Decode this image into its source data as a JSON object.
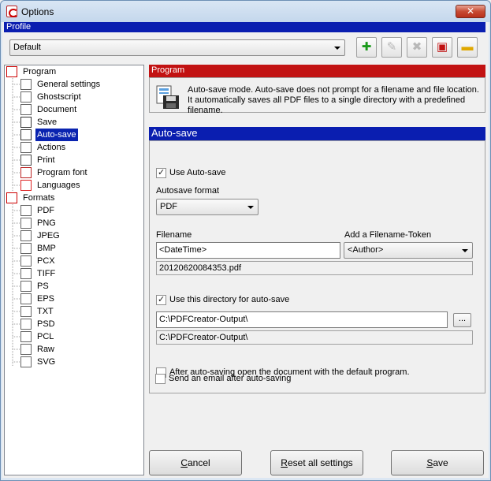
{
  "window": {
    "title": "Options",
    "close_glyph": "✕"
  },
  "profile": {
    "header": "Profile",
    "selected": "Default",
    "toolbar": [
      {
        "name": "add-profile-button",
        "icon": "plus-icon",
        "glyph": "✚",
        "color": "#1a9a1a",
        "disabled": false
      },
      {
        "name": "rename-profile-button",
        "icon": "rename-icon",
        "glyph": "✎",
        "color": "#b8b8b8",
        "disabled": true
      },
      {
        "name": "delete-profile-button",
        "icon": "delete-icon",
        "glyph": "✖",
        "color": "#b8b8b8",
        "disabled": true
      },
      {
        "name": "save-profile-button",
        "icon": "floppy-icon",
        "glyph": "▣",
        "color": "#c01010",
        "disabled": false
      },
      {
        "name": "open-profile-button",
        "icon": "folder-icon",
        "glyph": "▬",
        "color": "#e0a800",
        "disabled": false
      }
    ]
  },
  "tree": {
    "program": {
      "label": "Program",
      "icon": "pdfcreator-icon"
    },
    "program_items": [
      {
        "label": "General settings",
        "icon": "document-icon"
      },
      {
        "label": "Ghostscript",
        "icon": "ghostscript-icon"
      },
      {
        "label": "Document",
        "icon": "document-icon"
      },
      {
        "label": "Save",
        "icon": "floppy-icon"
      },
      {
        "label": "Auto-save",
        "icon": "autosave-icon",
        "selected": true
      },
      {
        "label": "Actions",
        "icon": "actions-icon"
      },
      {
        "label": "Print",
        "icon": "printer-icon"
      },
      {
        "label": "Program font",
        "icon": "font-icon"
      },
      {
        "label": "Languages",
        "icon": "flag-icon"
      }
    ],
    "formats": {
      "label": "Formats",
      "icon": "formats-icon"
    },
    "format_items": [
      {
        "label": "PDF",
        "icon": "pdf-file-icon"
      },
      {
        "label": "PNG",
        "icon": "png-file-icon"
      },
      {
        "label": "JPEG",
        "icon": "jpeg-file-icon"
      },
      {
        "label": "BMP",
        "icon": "bmp-file-icon"
      },
      {
        "label": "PCX",
        "icon": "pcx-file-icon"
      },
      {
        "label": "TIFF",
        "icon": "tiff-file-icon"
      },
      {
        "label": "PS",
        "icon": "ps-file-icon"
      },
      {
        "label": "EPS",
        "icon": "eps-file-icon"
      },
      {
        "label": "TXT",
        "icon": "txt-file-icon"
      },
      {
        "label": "PSD",
        "icon": "psd-file-icon"
      },
      {
        "label": "PCL",
        "icon": "pcl-file-icon"
      },
      {
        "label": "Raw",
        "icon": "raw-file-icon"
      },
      {
        "label": "SVG",
        "icon": "svg-file-icon"
      }
    ]
  },
  "program_section": {
    "header": "Program",
    "description": "Auto-save mode. Auto-save does not prompt for a filename and file location. It automatically saves all PDF files to a single directory with a predefined filename."
  },
  "autosave": {
    "header": "Auto-save",
    "use_autosave": {
      "label": "Use Auto-save",
      "checked": true
    },
    "format_label": "Autosave format",
    "format_value": "PDF",
    "filename_label": "Filename",
    "filename_value": "<DateTime>",
    "token_label": "Add a Filename-Token",
    "token_value": "<Author>",
    "filename_preview": "20120620084353.pdf",
    "use_directory": {
      "label": "Use this directory for auto-save",
      "checked": true
    },
    "directory_value": "C:\\PDFCreator-Output\\",
    "browse_label": "...",
    "directory_preview": "C:\\PDFCreator-Output\\",
    "open_after": {
      "label": "After auto-saving open the document with the default program.",
      "checked": false
    },
    "send_email": {
      "label": "Send an email after auto-saving",
      "checked": false
    }
  },
  "buttons": {
    "cancel": {
      "mnemonic": "C",
      "rest": "ancel"
    },
    "reset": {
      "mnemonic": "R",
      "rest": "eset all settings"
    },
    "save": {
      "mnemonic": "S",
      "rest": "ave"
    }
  }
}
